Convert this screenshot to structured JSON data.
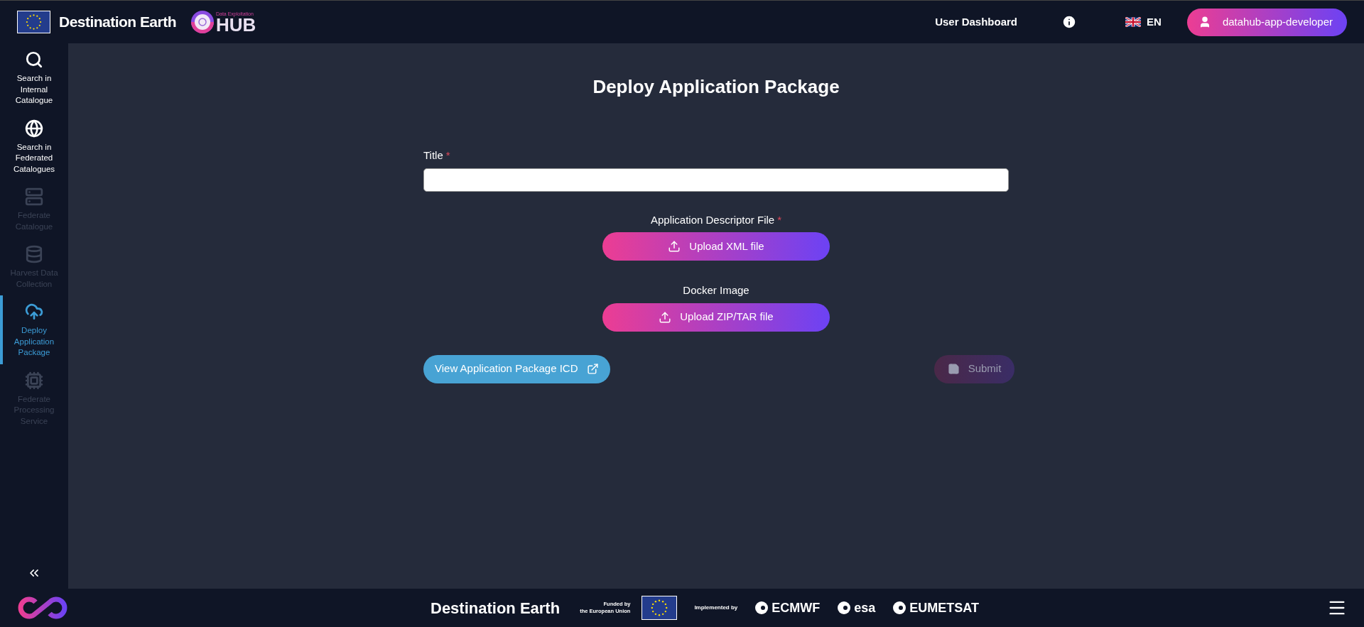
{
  "header": {
    "brand": "Destination Earth",
    "hub_caption": "Data Exploitation",
    "hub_title": "HUB",
    "nav_link": "User Dashboard",
    "language": "EN",
    "user": "datahub-app-developer"
  },
  "sidebar": {
    "items": [
      {
        "label": "Search in Internal Catalogue",
        "selected": false,
        "disabled": false
      },
      {
        "label": "Search in Federated Catalogues",
        "selected": false,
        "disabled": false
      },
      {
        "label": "Federate Catalogue",
        "selected": false,
        "disabled": true
      },
      {
        "label": "Harvest Data Collection",
        "selected": false,
        "disabled": true
      },
      {
        "label": "Deploy Application Package",
        "selected": true,
        "disabled": false
      },
      {
        "label": "Federate Processing Service",
        "selected": false,
        "disabled": true
      }
    ]
  },
  "page": {
    "title": "Deploy Application Package"
  },
  "form": {
    "required_mark": "*",
    "title_field": {
      "label": "Title",
      "required": true
    },
    "uploads": [
      {
        "label": "Application Descriptor File",
        "required": true,
        "button": "Upload XML file"
      },
      {
        "label": "Docker Image",
        "required": false,
        "button": "Upload ZIP/TAR file"
      }
    ]
  },
  "actions": {
    "icd_link": "View Application Package ICD",
    "submit": {
      "label": "Submit",
      "disabled": true
    }
  },
  "footer": {
    "brand": "Destination Earth",
    "funded_line_1": "Funded by",
    "funded_line_2": "the European Union",
    "implemented_by": "Implemented by",
    "partners": [
      "ECMWF",
      "esa",
      "EUMETSAT"
    ]
  }
}
